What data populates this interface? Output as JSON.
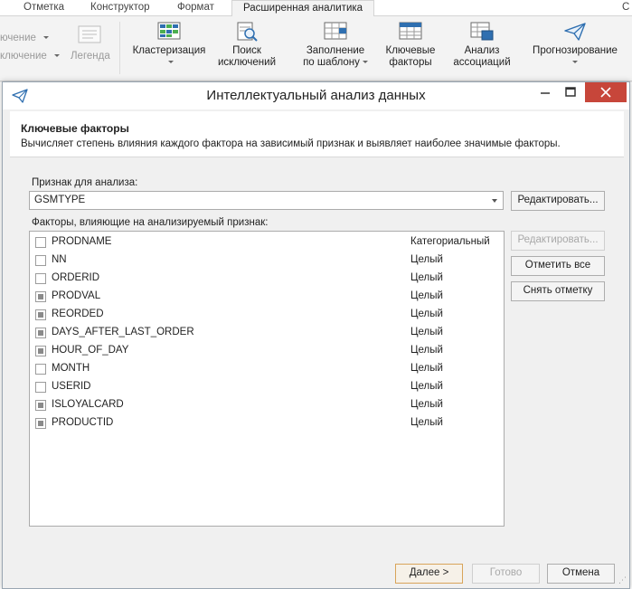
{
  "ribbon": {
    "tabs": [
      {
        "label": "Отметка"
      },
      {
        "label": "Конструктор"
      },
      {
        "label": "Формат"
      },
      {
        "label": "Расширенная аналитика"
      }
    ],
    "right_cut": "С",
    "left_items": [
      {
        "label": "ючение"
      },
      {
        "label": "ключение"
      },
      {
        "label": "Легенда"
      }
    ],
    "buttons": [
      {
        "line1": "Кластеризация",
        "line2": ""
      },
      {
        "line1": "Поиск",
        "line2": "исключений"
      },
      {
        "line1": "Заполнение",
        "line2": "по шаблону"
      },
      {
        "line1": "Ключевые",
        "line2": "факторы"
      },
      {
        "line1": "Анализ",
        "line2": "ассоциаций"
      },
      {
        "line1": "Прогнозирование",
        "line2": ""
      }
    ]
  },
  "dialog": {
    "title": "Интеллектуальный анализ данных",
    "header": {
      "title": "Ключевые факторы",
      "description": "Вычисляет степень влияния каждого фактора на зависимый признак и выявляет наиболее значимые факторы."
    },
    "target": {
      "label": "Признак для анализа:",
      "value": "GSMTYPE",
      "edit_button": "Редактировать..."
    },
    "factors": {
      "label": "Факторы, влияющие на анализируемый признак:",
      "rows": [
        {
          "name": "PRODNAME",
          "type": "Категориальный",
          "checked": false
        },
        {
          "name": "NN",
          "type": "Целый",
          "checked": false
        },
        {
          "name": "ORDERID",
          "type": "Целый",
          "checked": false
        },
        {
          "name": "PRODVAL",
          "type": "Целый",
          "checked": true
        },
        {
          "name": "REORDED",
          "type": "Целый",
          "checked": true
        },
        {
          "name": "DAYS_AFTER_LAST_ORDER",
          "type": "Целый",
          "checked": true
        },
        {
          "name": "HOUR_OF_DAY",
          "type": "Целый",
          "checked": true
        },
        {
          "name": "MONTH",
          "type": "Целый",
          "checked": false
        },
        {
          "name": "USERID",
          "type": "Целый",
          "checked": false
        },
        {
          "name": "ISLOYALCARD",
          "type": "Целый",
          "checked": true
        },
        {
          "name": "PRODUCTID",
          "type": "Целый",
          "checked": true
        }
      ],
      "edit_button": "Редактировать...",
      "check_all_button": "Отметить все",
      "uncheck_button": "Снять отметку"
    },
    "footer": {
      "next_button": "Далее >",
      "finish_button": "Готово",
      "cancel_button": "Отмена"
    }
  },
  "colors": {
    "close_button": "#c7463a",
    "primary_border": "#d8a45a",
    "icon_blue": "#2f6fb0"
  }
}
